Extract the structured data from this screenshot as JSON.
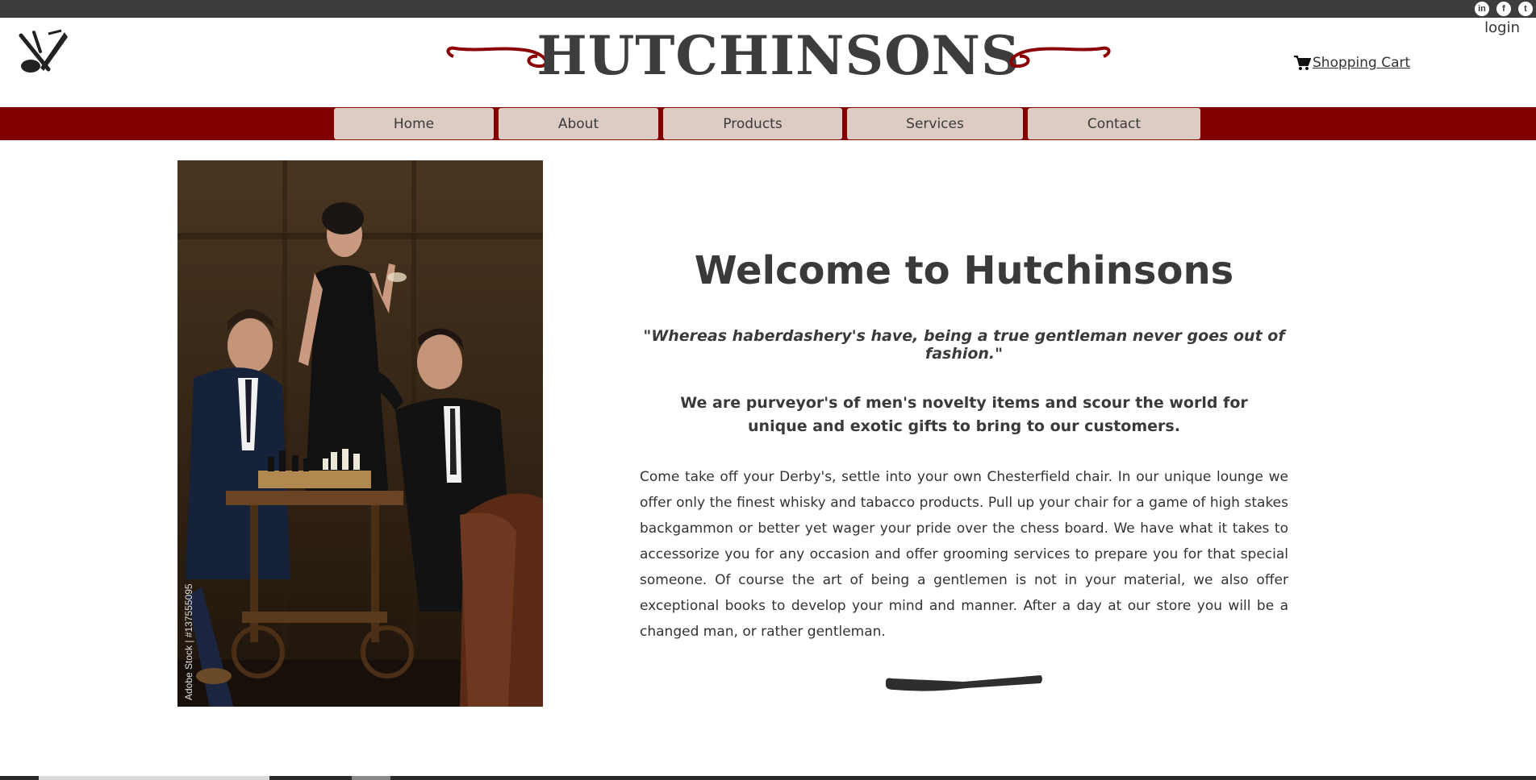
{
  "header": {
    "brand": "HUTCHINSONS",
    "login": "login",
    "cart_label": "Shopping Cart",
    "social": [
      {
        "icon": "linkedin-icon",
        "glyph": "in"
      },
      {
        "icon": "facebook-icon",
        "glyph": "f"
      },
      {
        "icon": "twitter-icon",
        "glyph": "t"
      }
    ]
  },
  "nav": {
    "items": [
      {
        "label": "Home"
      },
      {
        "label": "About"
      },
      {
        "label": "Products"
      },
      {
        "label": "Services"
      },
      {
        "label": "Contact"
      }
    ]
  },
  "hero": {
    "watermark": "Adobe Stock | #137555095"
  },
  "main": {
    "title": "Welcome to Hutchinsons",
    "quote": "\"Whereas haberdashery's have, being a true gentleman never goes out of fashion.\"",
    "tagline": "We are purveyor's of men's novelty items and scour the world for unique and exotic gifts to bring to our customers.",
    "body": "Come take off your Derby's, settle into your own Chesterfield chair. In our unique lounge we offer only the finest whisky and tabacco products. Pull up your chair for a game of high stakes backgammon or better yet wager your pride over the chess board. We have what it takes to accessorize you for any occasion and offer grooming services to prepare you for that special someone. Of course the art of being a gentlemen is not in your material, we also offer exceptional books to develop your mind and manner. After a day at our store you will be a changed man, or rather gentleman."
  },
  "colors": {
    "topbar": "#3d3d3d",
    "navbar": "#800000",
    "nav_button": "#dcccc4",
    "swirl": "#8b0000"
  }
}
